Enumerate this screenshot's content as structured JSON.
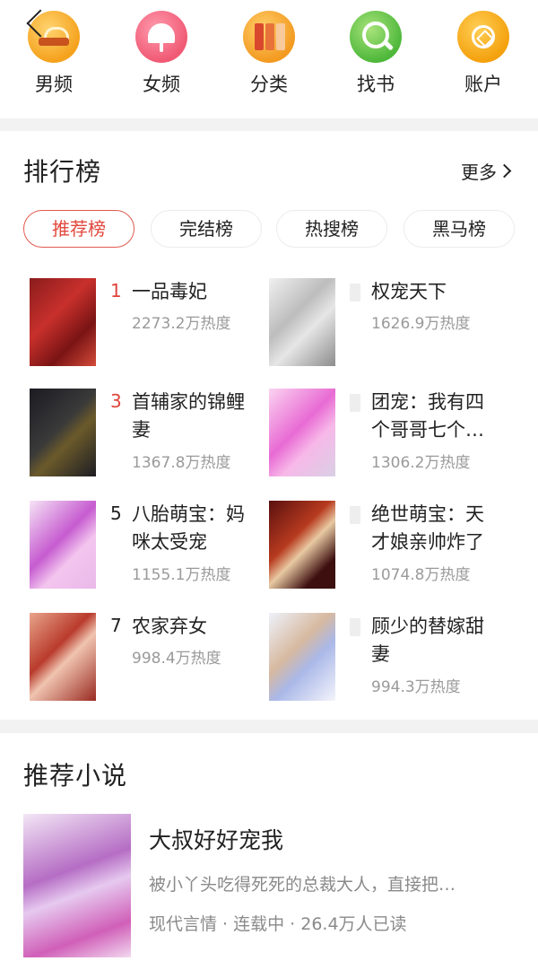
{
  "nav": {
    "items": [
      {
        "label": "男频",
        "icon": "male-channel-icon"
      },
      {
        "label": "女频",
        "icon": "female-channel-icon"
      },
      {
        "label": "分类",
        "icon": "category-books-icon"
      },
      {
        "label": "找书",
        "icon": "search-book-icon"
      },
      {
        "label": "账户",
        "icon": "coin-account-icon"
      }
    ]
  },
  "ranking": {
    "title": "排行榜",
    "more": "更多",
    "tabs": [
      {
        "label": "推荐榜",
        "active": true
      },
      {
        "label": "完结榜",
        "active": false
      },
      {
        "label": "热搜榜",
        "active": false
      },
      {
        "label": "黑马榜",
        "active": false
      }
    ],
    "items": [
      {
        "rank": "1",
        "title": "一品毒妃",
        "heat": "2273.2万热度"
      },
      {
        "rank": "",
        "title": "权宠天下",
        "heat": "1626.9万热度"
      },
      {
        "rank": "3",
        "title": "首辅家的锦鲤妻",
        "heat": "1367.8万热度"
      },
      {
        "rank": "",
        "title": "团宠：我有四个哥哥七个…",
        "heat": "1306.2万热度"
      },
      {
        "rank": "5",
        "title": "八胎萌宝：妈咪太受宠",
        "heat": "1155.1万热度"
      },
      {
        "rank": "",
        "title": "绝世萌宝：天才娘亲帅炸了",
        "heat": "1074.8万热度"
      },
      {
        "rank": "7",
        "title": "农家弃女",
        "heat": "998.4万热度"
      },
      {
        "rank": "",
        "title": "顾少的替嫁甜妻",
        "heat": "994.3万热度"
      }
    ]
  },
  "recommend": {
    "title": "推荐小说",
    "book": {
      "title": "大叔好好宠我",
      "desc": "被小丫头吃得死死的总裁大人，直接把…",
      "meta": "现代言情 · 连载中 · 26.4万人已读"
    }
  },
  "colors": {
    "accent": "#e2483d",
    "muted": "#9a9a9a",
    "divider": "#f2f2f2"
  }
}
